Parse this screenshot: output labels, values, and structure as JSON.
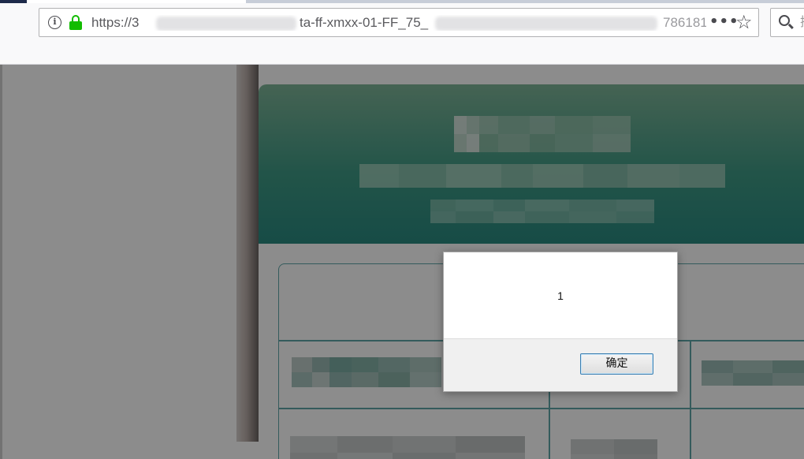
{
  "browser": {
    "url_prefix": "https://3",
    "url_path": "ta-ff-xmxx-01-FF_75_",
    "url_tail": "786181",
    "menu_glyph": "•••",
    "bookmark_glyph": "☆",
    "search_placeholder": "搜"
  },
  "dialog": {
    "message": "1",
    "ok_label": "确定"
  },
  "colors": {
    "header_top": "#7fb598",
    "header_bottom": "#2a8a80",
    "table_line": "#5fa6a8",
    "lock_green": "#12bc00",
    "dialog_button_border": "#3c7fb1"
  },
  "icons": {
    "info": "info-icon",
    "lock": "lock-icon",
    "more": "dots-icon",
    "bookmark": "star-icon",
    "search": "search-icon"
  }
}
